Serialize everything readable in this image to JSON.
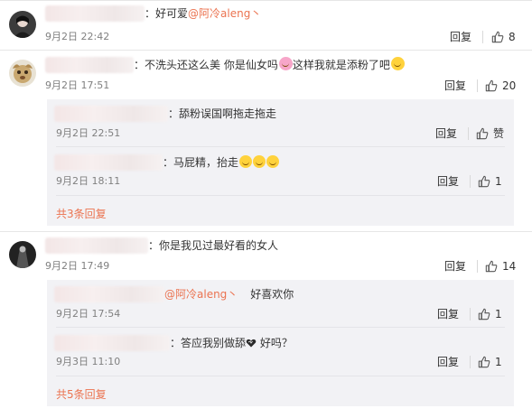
{
  "comments": [
    {
      "text_prefix": "：",
      "mention": "",
      "text": "好可爱",
      "mention_after": "@阿冷aleng丶",
      "date": "9月2日 22:42",
      "reply_label": "回复",
      "likes": "8"
    },
    {
      "text_a": "：不洗头还这么美 你是仙女吗",
      "text_b": "这样我就是添粉了吧",
      "date": "9月2日 17:51",
      "reply_label": "回复",
      "likes": "20",
      "replies": [
        {
          "text": "：舔粉误国啊拖走拖走",
          "date": "9月2日 22:51",
          "reply_label": "回复",
          "likes": "赞"
        },
        {
          "text": "：马屁精，抬走",
          "date": "9月2日 18:11",
          "reply_label": "回复",
          "likes": "1"
        }
      ],
      "more_label": "共3条回复"
    },
    {
      "text": "：你是我见过最好看的女人",
      "date": "9月2日 17:49",
      "reply_label": "回复",
      "likes": "14",
      "replies": [
        {
          "mention": "@阿冷aleng丶",
          "text": "好喜欢你",
          "date": "9月2日 17:54",
          "reply_label": "回复",
          "likes": "1"
        },
        {
          "text_a": "：答应我别做舔",
          "text_b": " 好吗？",
          "date": "9月3日 11:10",
          "reply_label": "回复",
          "likes": "1"
        }
      ],
      "more_label": "共5条回复"
    }
  ],
  "colors": {
    "link": "#eb7350",
    "meta": "#808080",
    "sub_bg": "#f2f2f5"
  }
}
